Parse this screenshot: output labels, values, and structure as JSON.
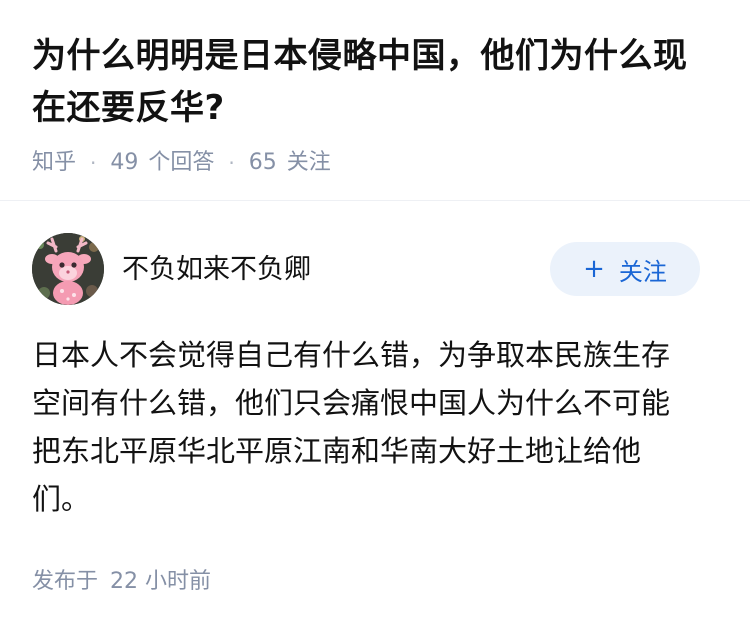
{
  "question": {
    "title": "为什么明明是日本侵略中国，他们为什么现在还要反华?",
    "source": "知乎",
    "answer_count": "49",
    "answer_label": "个回答",
    "follow_count": "65",
    "follow_label": "关注",
    "separator": "·"
  },
  "answer": {
    "author_name": "不负如来不负卿",
    "avatar_icon": "pink-deer-avatar",
    "follow_button_label": "关注",
    "follow_button_icon": "+",
    "content": "日本人不会觉得自己有什么错，为争取本民族生存空间有什么错，他们只会痛恨中国人为什么不可能把东北平原华北平原江南和华南大好土地让给他们。",
    "publish_label": "发布于",
    "publish_time": "22 小时前"
  },
  "colors": {
    "text": "#121212",
    "meta": "#8590a6",
    "accent": "#1a66d5",
    "button_bg": "#ebf2fb",
    "divider": "#eef0f4"
  }
}
